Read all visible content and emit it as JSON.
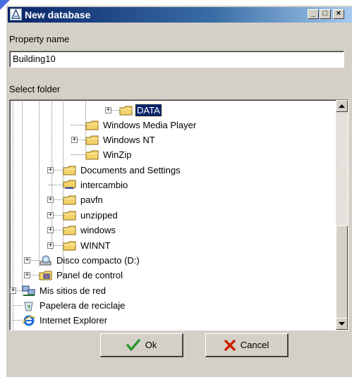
{
  "window": {
    "title": "New database",
    "minimize_glyph": "_",
    "maximize_glyph": "□",
    "close_glyph": "×"
  },
  "form": {
    "property_label": "Property name",
    "property_value": "Building10",
    "folder_label": "Select folder"
  },
  "tree": {
    "items": [
      {
        "label": "DATA",
        "icon": "folder-icon",
        "selected": true,
        "expander": "+"
      },
      {
        "label": "Windows Media Player",
        "icon": "folder-icon",
        "selected": false,
        "expander": ""
      },
      {
        "label": "Windows NT",
        "icon": "folder-icon",
        "selected": false,
        "expander": "+"
      },
      {
        "label": "WinZip",
        "icon": "folder-icon",
        "selected": false,
        "expander": ""
      },
      {
        "label": "Documents and Settings",
        "icon": "folder-icon",
        "selected": false,
        "expander": "+"
      },
      {
        "label": "intercambio",
        "icon": "shared-folder-icon",
        "selected": false,
        "expander": ""
      },
      {
        "label": "pavfn",
        "icon": "folder-icon",
        "selected": false,
        "expander": "+"
      },
      {
        "label": "unzipped",
        "icon": "folder-icon",
        "selected": false,
        "expander": "+"
      },
      {
        "label": "windows",
        "icon": "folder-icon",
        "selected": false,
        "expander": "+"
      },
      {
        "label": "WINNT",
        "icon": "folder-icon",
        "selected": false,
        "expander": "+"
      },
      {
        "label": "Disco compacto (D:)",
        "icon": "cd-drive-icon",
        "selected": false,
        "expander": "+"
      },
      {
        "label": "Panel de control",
        "icon": "control-panel-icon",
        "selected": false,
        "expander": "+"
      },
      {
        "label": "Mis sitios de red",
        "icon": "network-places-icon",
        "selected": false,
        "expander": "+"
      },
      {
        "label": "Papelera de reciclaje",
        "icon": "recycle-bin-icon",
        "selected": false,
        "expander": ""
      },
      {
        "label": "Internet Explorer",
        "icon": "internet-explorer-icon",
        "selected": false,
        "expander": ""
      }
    ]
  },
  "buttons": {
    "ok_label": "Ok",
    "cancel_label": "Cancel"
  },
  "colors": {
    "title_bar": "#0a246a",
    "selection": "#0a246a",
    "folder": "#f5d36b",
    "ok_check": "#2e9a2e",
    "cancel_x": "#cc2200"
  }
}
